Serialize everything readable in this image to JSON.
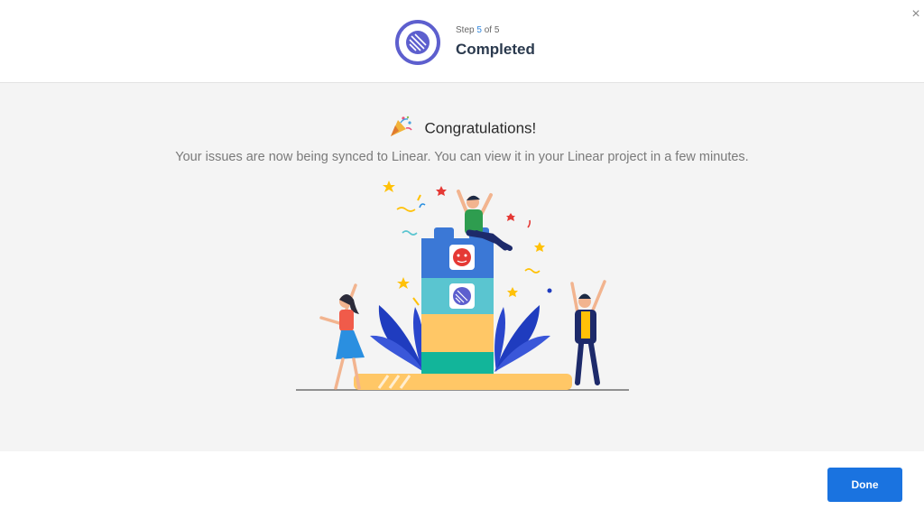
{
  "header": {
    "step_prefix": "Step",
    "step_current": "5",
    "step_suffix": "of 5",
    "title": "Completed",
    "close_icon": "×"
  },
  "main": {
    "heading": "Congratulations!",
    "message": "Your issues are now being synced to Linear. You can view it in your Linear project in a few minutes."
  },
  "footer": {
    "done_label": "Done"
  },
  "colors": {
    "accent": "#1a73e0",
    "step_ring": "#5d5fce",
    "step_current": "#2f86de"
  },
  "icons": [
    "linear-logo-icon",
    "close-icon",
    "party-popper-icon",
    "tiger-logo-icon"
  ]
}
